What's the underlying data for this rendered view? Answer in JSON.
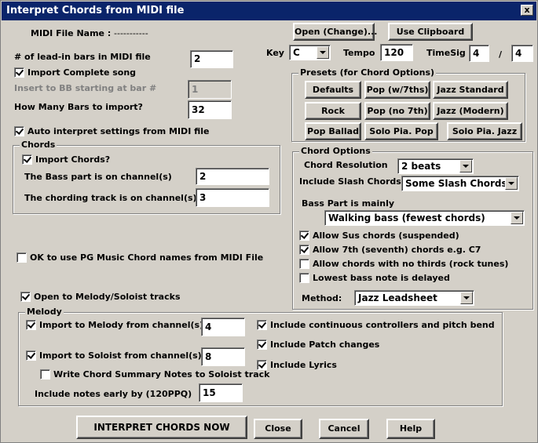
{
  "window": {
    "title": "Interpret Chords from MIDI file",
    "close_glyph": "x"
  },
  "midi": {
    "file_name_label": "MIDI File Name :",
    "file_name_value": "-----------"
  },
  "buttons": {
    "open_change": "Open (Change)...",
    "use_clipboard": "Use Clipboard",
    "interpret": "INTERPRET CHORDS NOW",
    "close": "Close",
    "cancel": "Cancel",
    "help": "Help"
  },
  "key": {
    "label": "Key",
    "value": "C"
  },
  "tempo": {
    "label": "Tempo",
    "value": "120"
  },
  "timesig": {
    "label": "TimeSig",
    "numerator": "4",
    "slash": "/",
    "denominator": "4"
  },
  "leadin": {
    "label": "# of lead-in bars in MIDI file",
    "value": "2"
  },
  "import_complete": {
    "label": "Import Complete song",
    "checked": true
  },
  "insert_bar": {
    "label": "Insert to BB starting at bar #",
    "value": "1"
  },
  "how_many": {
    "label": "How Many Bars to import?",
    "value": "32"
  },
  "auto_interpret": {
    "label": "Auto interpret settings from MIDI file",
    "checked": true
  },
  "chords_group": {
    "title": "Chords",
    "import_chords": {
      "label": "Import Chords?",
      "checked": true
    },
    "bass_label": "The Bass part is on channel(s)",
    "bass_value": "2",
    "chording_label": "The chording track is on channel(s)",
    "chording_value": "3"
  },
  "presets": {
    "title": "Presets  (for Chord Options)",
    "items": [
      "Defaults",
      "Pop (w/7ths)",
      "Jazz Standard",
      "Rock",
      "Pop (no 7th)",
      "Jazz (Modern)",
      "Pop Ballad",
      "Solo Pia. Pop",
      "Solo Pia. Jazz"
    ]
  },
  "chord_options": {
    "title": "Chord Options",
    "resolution_label": "Chord Resolution",
    "resolution_value": "2 beats",
    "slash_label": "Include Slash Chords",
    "slash_value": "Some Slash Chords",
    "bass_label": "Bass Part is mainly",
    "bass_value": "Walking bass (fewest chords)",
    "checks": [
      {
        "label": "Allow Sus chords (suspended)",
        "checked": true
      },
      {
        "label": "Allow 7th (seventh) chords e.g. C7",
        "checked": true
      },
      {
        "label": "Allow chords with no thirds (rock tunes)",
        "checked": false
      },
      {
        "label": "Lowest bass note is delayed",
        "checked": false
      }
    ],
    "method_label": "Method:",
    "method_value": "Jazz Leadsheet"
  },
  "pg_names": {
    "label": "OK to use PG Music Chord names from MIDI File",
    "checked": false
  },
  "open_melody": {
    "label": "Open to Melody/Soloist tracks",
    "checked": true
  },
  "melody_group": {
    "title": "Melody",
    "import_melody": {
      "label": "Import to Melody from channel(s)",
      "checked": true,
      "value": "4"
    },
    "import_soloist": {
      "label": "Import to Soloist from channel(s)",
      "checked": true,
      "value": "8"
    },
    "write_summary": {
      "label": "Write Chord Summary Notes to Soloist track",
      "checked": false
    },
    "early_label": "Include notes early by (120PPQ)",
    "early_value": "15",
    "controllers": {
      "label": "Include continuous controllers and pitch bend",
      "checked": true
    },
    "patch": {
      "label": "Include Patch changes",
      "checked": true
    },
    "lyrics": {
      "label": "Include Lyrics",
      "checked": true
    }
  }
}
